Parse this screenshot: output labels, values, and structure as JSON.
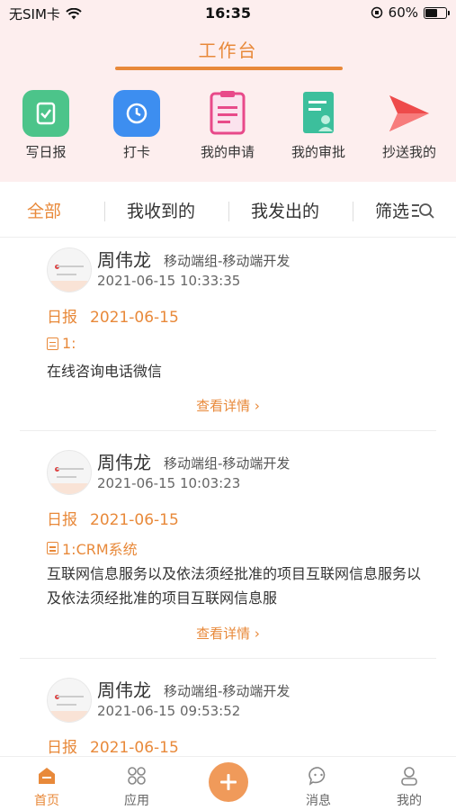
{
  "status_bar": {
    "carrier": "无SIM卡",
    "time": "16:35",
    "battery": "60%",
    "battery_level": 0.6
  },
  "header": {
    "title": "工作台"
  },
  "shortcuts": [
    {
      "label": "写日报",
      "icon": "daily-report-icon",
      "color": "#4cc48a"
    },
    {
      "label": "打卡",
      "icon": "clock-in-icon",
      "color": "#3d8ef0"
    },
    {
      "label": "我的申请",
      "icon": "application-icon",
      "color": "#e84a8a"
    },
    {
      "label": "我的审批",
      "icon": "approval-icon",
      "color": "#3cbf9c"
    },
    {
      "label": "抄送我的",
      "icon": "send-icon",
      "color": "#ee4b4b"
    }
  ],
  "filter": {
    "tabs": [
      "全部",
      "我收到的",
      "我发出的"
    ],
    "filter_label": "筛选"
  },
  "feed": [
    {
      "name": "周伟龙",
      "dept": "移动端组-移动端开发",
      "time": "2021-06-15 10:33:35",
      "type": "日报",
      "date": "2021-06-15",
      "item": "1:",
      "content": "在线咨询电话微信",
      "detail": "查看详情"
    },
    {
      "name": "周伟龙",
      "dept": "移动端组-移动端开发",
      "time": "2021-06-15 10:03:23",
      "type": "日报",
      "date": "2021-06-15",
      "item": "1:CRM系统",
      "content": "互联网信息服务以及依法须经批准的项目互联网信息服务以及依法须经批准的项目互联网信息服",
      "detail": "查看详情"
    },
    {
      "name": "周伟龙",
      "dept": "移动端组-移动端开发",
      "time": "2021-06-15 09:53:52",
      "type": "日报",
      "date": "2021-06-15"
    }
  ],
  "tabbar": {
    "items": [
      {
        "label": "首页",
        "icon": "home-icon"
      },
      {
        "label": "应用",
        "icon": "apps-icon"
      },
      {
        "label": "",
        "icon": "plus-icon"
      },
      {
        "label": "消息",
        "icon": "message-icon"
      },
      {
        "label": "我的",
        "icon": "profile-icon"
      }
    ]
  },
  "colors": {
    "accent": "#e8893a",
    "header_bg": "#fdeeee"
  }
}
